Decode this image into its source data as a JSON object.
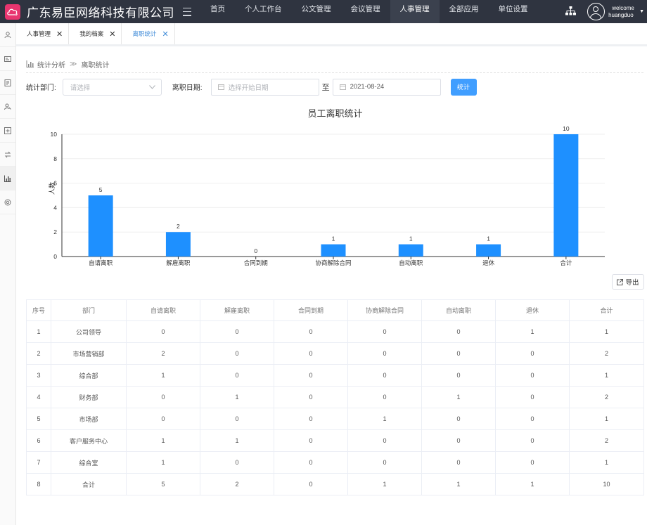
{
  "header": {
    "company": "广东易臣网络科技有限公司",
    "nav": [
      "首页",
      "个人工作台",
      "公文管理",
      "会议管理",
      "人事管理",
      "全部应用",
      "单位设置"
    ],
    "active_nav": 4,
    "welcome": "welcome",
    "username": "huangduo"
  },
  "tabs": [
    {
      "label": "人事管理",
      "active": false
    },
    {
      "label": "我的档案",
      "active": false
    },
    {
      "label": "离职统计",
      "active": true
    }
  ],
  "sidebar_icons": [
    "user-icon",
    "id-card-icon",
    "document-icon",
    "person-edit-icon",
    "plus-box-icon",
    "transfer-icon",
    "bar-chart-icon",
    "settings-icon"
  ],
  "breadcrumb": {
    "parent": "统计分析",
    "sep": "≫",
    "current": "离职统计"
  },
  "filters": {
    "dept_label": "统计部门:",
    "dept_placeholder": "请选择",
    "date_label": "离职日期:",
    "start_placeholder": "选择开始日期",
    "to": "至",
    "end_value": "2021-08-24",
    "stat_button": "统计"
  },
  "export_button": "导出",
  "colors": {
    "accent": "#409eff",
    "bar": "#1e90ff",
    "topbar": "#2f3440"
  },
  "chart_data": {
    "type": "bar",
    "title": "员工离职统计",
    "ylabel": "人数",
    "categories": [
      "自请离职",
      "解雇离职",
      "合同到期",
      "协商解除合同",
      "自动离职",
      "退休",
      "合计"
    ],
    "values": [
      5,
      2,
      0,
      1,
      1,
      1,
      10
    ],
    "ylim": [
      0,
      10
    ],
    "yticks": [
      0,
      2,
      4,
      6,
      8,
      10
    ],
    "grid": true
  },
  "table": {
    "headers": [
      "序号",
      "部门",
      "自请离职",
      "解雇离职",
      "合同到期",
      "协商解除合同",
      "自动离职",
      "退休",
      "合计"
    ],
    "rows": [
      [
        "1",
        "公司领导",
        "0",
        "0",
        "0",
        "0",
        "0",
        "1",
        "1"
      ],
      [
        "2",
        "市场营销部",
        "2",
        "0",
        "0",
        "0",
        "0",
        "0",
        "2"
      ],
      [
        "3",
        "综合部",
        "1",
        "0",
        "0",
        "0",
        "0",
        "0",
        "1"
      ],
      [
        "4",
        "财务部",
        "0",
        "1",
        "0",
        "0",
        "1",
        "0",
        "2"
      ],
      [
        "5",
        "市场部",
        "0",
        "0",
        "0",
        "1",
        "0",
        "0",
        "1"
      ],
      [
        "6",
        "客户服务中心",
        "1",
        "1",
        "0",
        "0",
        "0",
        "0",
        "2"
      ],
      [
        "7",
        "综合室",
        "1",
        "0",
        "0",
        "0",
        "0",
        "0",
        "1"
      ],
      [
        "8",
        "合计",
        "5",
        "2",
        "0",
        "1",
        "1",
        "1",
        "10"
      ]
    ]
  }
}
